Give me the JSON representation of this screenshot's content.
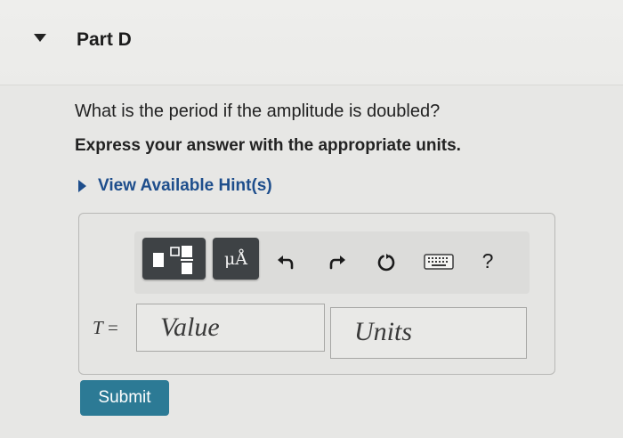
{
  "part": {
    "title": "Part D",
    "expanded": true
  },
  "question": {
    "text": "What is the period if the amplitude is doubled?",
    "instruction": "Express your answer with the appropriate units."
  },
  "hint": {
    "label": "View Available Hint(s)"
  },
  "toolbar": {
    "templates_icon": "templates-icon",
    "units_label": "μÅ",
    "undo_icon": "undo-icon",
    "redo_icon": "redo-icon",
    "reset_icon": "reset-icon",
    "keyboard_icon": "keyboard-icon",
    "help_label": "?"
  },
  "answer": {
    "variable": "T",
    "equals": "=",
    "value_placeholder": "Value",
    "units_placeholder": "Units"
  },
  "submit": {
    "label": "Submit"
  },
  "colors": {
    "link": "#1e4e8c",
    "submit_bg": "#2c7a95",
    "toolbar_button": "#3e4245",
    "background": "#e7e7e5"
  }
}
